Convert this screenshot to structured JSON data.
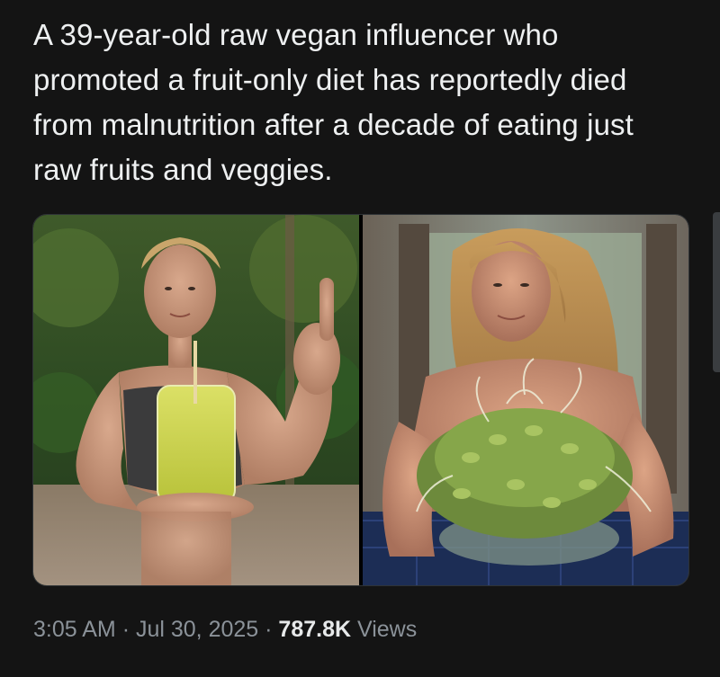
{
  "post": {
    "text": "A 39-year-old raw vegan influencer who promoted a fruit-only diet has reportedly died from malnutrition after a decade of eating just raw fruits and veggies."
  },
  "media": [
    {
      "name": "photo-woman-holding-juice",
      "icon": "photo"
    },
    {
      "name": "photo-woman-holding-sprouts",
      "icon": "photo"
    }
  ],
  "meta": {
    "time": "3:05 AM",
    "separator": "·",
    "date": "Jul 30, 2025",
    "views_count": "787.8K",
    "views_label": "Views"
  },
  "colors": {
    "background": "#141414",
    "text": "#eef0f1",
    "muted": "#8b9299"
  }
}
